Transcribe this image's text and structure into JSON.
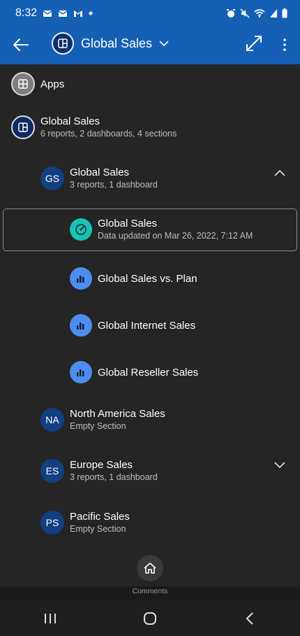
{
  "status_bar": {
    "time": "8:32"
  },
  "header": {
    "title": "Global Sales"
  },
  "nav": {
    "apps": {
      "label": "Apps"
    },
    "app": {
      "title": "Global Sales",
      "subtitle": "6 reports, 2 dashboards, 4 sections"
    },
    "sections": [
      {
        "initials": "GS",
        "title": "Global Sales",
        "subtitle": "3 reports, 1 dashboard",
        "expanded": true,
        "items": [
          {
            "type": "dashboard",
            "title": "Global Sales",
            "subtitle": "Data updated on Mar 26, 2022, 7:12 AM",
            "selected": true
          },
          {
            "type": "report",
            "title": "Global Sales vs. Plan"
          },
          {
            "type": "report",
            "title": "Global Internet Sales"
          },
          {
            "type": "report",
            "title": "Global Reseller Sales"
          }
        ]
      },
      {
        "initials": "NA",
        "title": "North America Sales",
        "subtitle": "Empty Section"
      },
      {
        "initials": "ES",
        "title": "Europe Sales",
        "subtitle": "3 reports, 1 dashboard",
        "expanded": false
      },
      {
        "initials": "PS",
        "title": "Pacific Sales",
        "subtitle": "Empty Section"
      }
    ]
  },
  "footer": {
    "comments_label": "Comments"
  },
  "colors": {
    "header_bg": "#1560b5",
    "panel_bg": "#252525",
    "dashboard_icon": "#17c3b2",
    "report_icon": "#4d8ef0",
    "section_avatar": "#123f7f"
  },
  "icons": {
    "status": [
      "outlook-mail-icon",
      "outlook-mail-icon",
      "gmail-icon",
      "notification-dot-icon",
      "alarm-icon",
      "mute-icon",
      "wifi-icon",
      "signal-icon",
      "battery-icon"
    ],
    "header": [
      "back-arrow-icon",
      "app-icon",
      "chevron-down-icon",
      "expand-icon",
      "more-vertical-icon"
    ]
  }
}
